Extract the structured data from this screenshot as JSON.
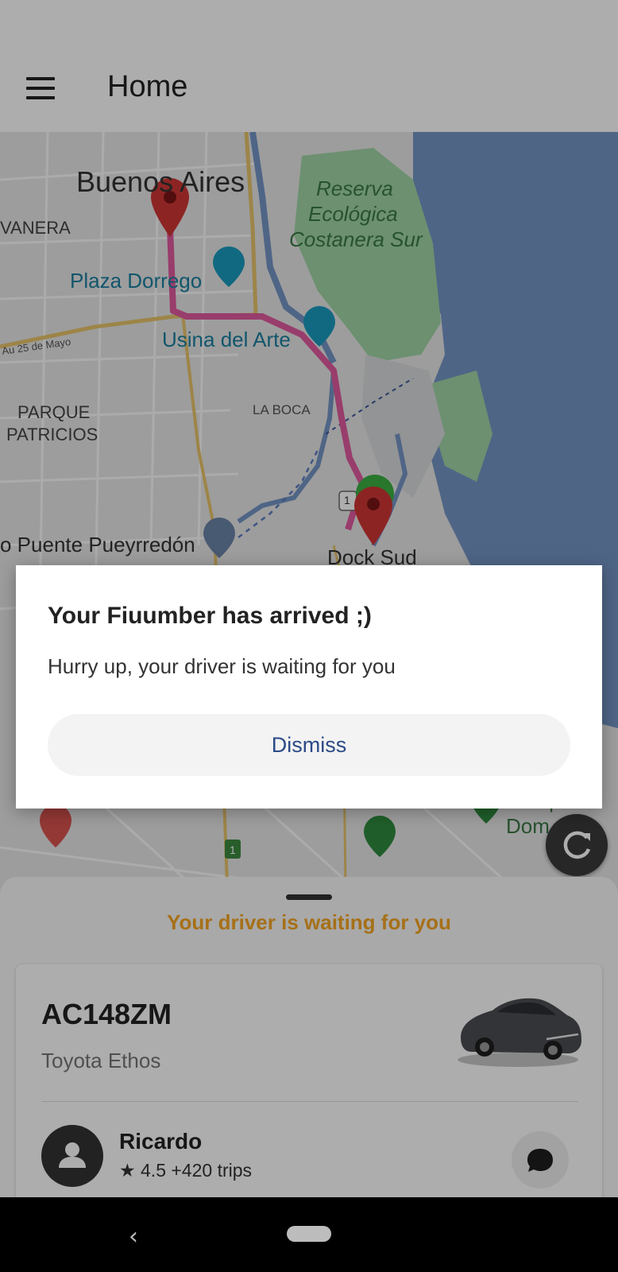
{
  "appbar": {
    "title": "Home",
    "menu_icon": "hamburger-menu-icon"
  },
  "map": {
    "labels": {
      "city": "Buenos Aires",
      "reserve": [
        "Reserva",
        "Ecológica",
        "Costanera Sur"
      ],
      "balvanera": "VANERA",
      "plaza": "Plaza Dorrego",
      "usina": "Usina del Arte",
      "avenue": "Au 25 de Mayo",
      "parque_patricios": [
        "PARQUE",
        "PATRICIOS"
      ],
      "la_boca": "LA BOCA",
      "puente": "o Puente Pueyrredón",
      "dock_sud": "Dock Sud",
      "parque_right": [
        "Parque",
        "Dom"
      ],
      "route_badge_1": "1",
      "route_badge_2": "1"
    },
    "icons": [
      "map-pin-origin-icon",
      "map-pin-destination-icon",
      "driver-location-icon",
      "camera-poi-icon",
      "palette-poi-icon",
      "bridge-poi-icon",
      "hospital-poi-icon",
      "tree-poi-icon",
      "park-poi-icon"
    ],
    "colors": {
      "water": "#7596c6",
      "park": "#9fd4a6",
      "route": "#e05aa0",
      "pin": "#d03636",
      "driver": "#3cb043"
    }
  },
  "refresh_button": {
    "icon": "refresh-icon"
  },
  "bottom_sheet": {
    "status": "Your driver is waiting for you",
    "status_color": "#f5a623",
    "vehicle": {
      "plate": "AC148ZM",
      "model": "Toyota Ethos",
      "icon": "car-image"
    },
    "driver": {
      "name": "Ricardo",
      "rating": "★ 4.5 +420 trips",
      "avatar_icon": "person-avatar-icon",
      "chat_icon": "chat-bubble-icon"
    }
  },
  "dialog": {
    "title": "Your Fiuumber has arrived ;)",
    "message": "Hurry up, your driver is waiting for you",
    "button": "Dismiss"
  },
  "navbar": {
    "back_icon": "back-icon",
    "home_icon": "home-pill-icon"
  }
}
